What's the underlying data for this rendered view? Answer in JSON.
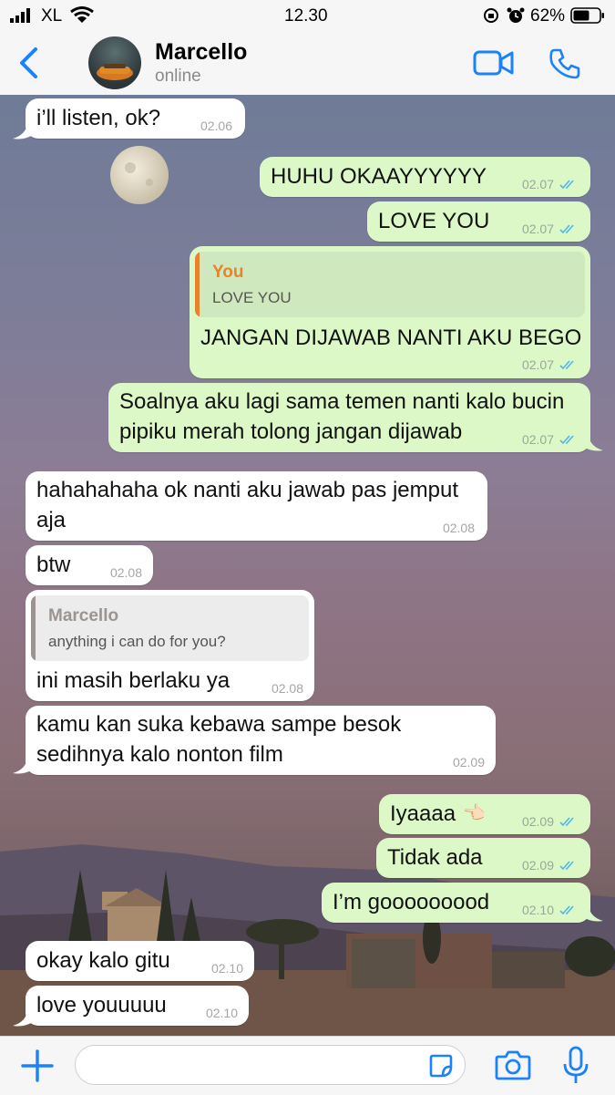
{
  "status_bar": {
    "carrier": "XL",
    "time": "12.30",
    "battery": "62%"
  },
  "header": {
    "contact_name": "Marcello",
    "contact_status": "online"
  },
  "messages": [
    {
      "text": "i’ll listen, ok?",
      "time": "02.06"
    },
    {
      "text": "HUHU OKAAYYYYYY",
      "time": "02.07"
    },
    {
      "text": "LOVE YOU",
      "time": "02.07"
    },
    {
      "quote_author": "You",
      "quote_text": "LOVE YOU",
      "text": "JANGAN DIJAWAB NANTI AKU BEGO",
      "time": "02.07"
    },
    {
      "lines": [
        "Soalnya aku lagi sama temen nanti kalo bucin",
        "pipiku merah tolong jangan dijawab"
      ],
      "time": "02.07"
    },
    {
      "lines": [
        "hahahahaha ok nanti aku jawab pas jemput",
        "aja"
      ],
      "time": "02.08"
    },
    {
      "text": "btw",
      "time": "02.08"
    },
    {
      "quote_author": "Marcello",
      "quote_text": "anything i can do for you?",
      "text": "ini masih berlaku ya",
      "time": "02.08"
    },
    {
      "lines": [
        "kamu kan suka kebawa sampe besok",
        "sedihnya kalo nonton film"
      ],
      "time": "02.09"
    },
    {
      "text": "Iyaaaa",
      "emoji": "👈🏻",
      "time": "02.09"
    },
    {
      "text": "Tidak ada",
      "time": "02.09"
    },
    {
      "text": "I’m gooooooood",
      "time": "02.10"
    },
    {
      "text": "okay kalo gitu",
      "time": "02.10"
    },
    {
      "text": "love youuuuu",
      "time": "02.10"
    }
  ],
  "colors": {
    "accent": "#1a82fb",
    "outgoing_bubble": "#dcf8c6",
    "incoming_bubble": "#ffffff",
    "read_ticks": "#4fb6ec",
    "quote_self": "#e6832c",
    "quote_contact": "#9c9490"
  },
  "icons": [
    "back-chevron-icon",
    "video-call-icon",
    "phone-call-icon",
    "plus-icon",
    "sticker-icon",
    "camera-icon",
    "microphone-icon"
  ]
}
